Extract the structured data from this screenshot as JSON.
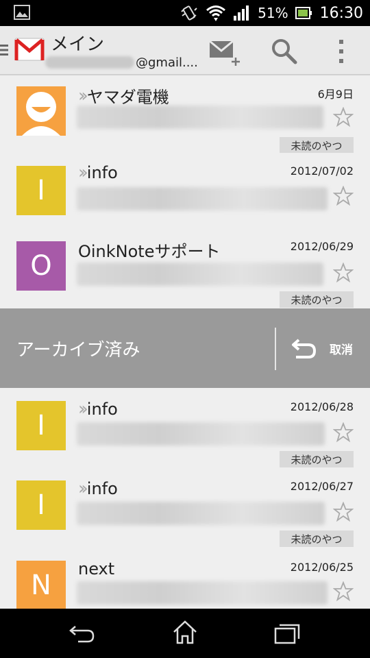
{
  "status_bar": {
    "battery_percent": "51%",
    "time": "16:30"
  },
  "action_bar": {
    "title": "メイン",
    "account_suffix": "@gmail....",
    "icons": [
      "gmail-logo",
      "compose-icon",
      "search-icon",
      "overflow-icon"
    ]
  },
  "emails": [
    {
      "sender": "ヤマダ電機",
      "date": "6月9日",
      "forwarded": true,
      "avatar_color": "#f6a140",
      "avatar_type": "person",
      "label": "未読のやつ"
    },
    {
      "sender": "info",
      "date": "2012/07/02",
      "forwarded": true,
      "avatar_color": "#e4c52c",
      "avatar_letter": "I",
      "label": ""
    },
    {
      "sender": "OinkNoteサポート",
      "date": "2012/06/29",
      "forwarded": false,
      "avatar_color": "#a75aa8",
      "avatar_letter": "O",
      "label": "未読のやつ"
    },
    {
      "sender": "info",
      "date": "2012/06/28",
      "forwarded": true,
      "avatar_color": "#e4c52c",
      "avatar_letter": "I",
      "label": "未読のやつ"
    },
    {
      "sender": "info",
      "date": "2012/06/27",
      "forwarded": true,
      "avatar_color": "#e4c52c",
      "avatar_letter": "I",
      "label": "未読のやつ"
    },
    {
      "sender": "next",
      "date": "2012/06/25",
      "forwarded": false,
      "avatar_color": "#f6a140",
      "avatar_letter": "N",
      "label": ""
    }
  ],
  "archive_bar": {
    "message": "アーカイブ済み",
    "undo_label": "取消"
  },
  "nav_bar": {
    "icons": [
      "back-icon",
      "home-icon",
      "recent-apps-icon"
    ]
  }
}
